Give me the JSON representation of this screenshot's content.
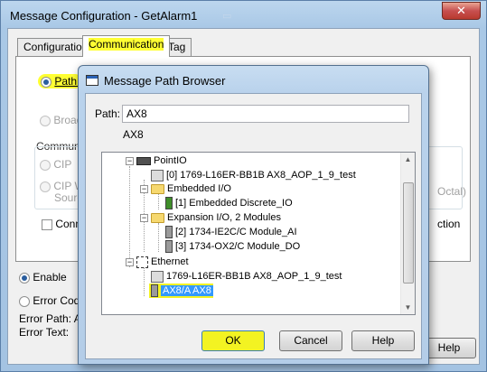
{
  "outer_window": {
    "title": "Message Configuration - GetAlarm1",
    "close_label": "✕",
    "tabs": [
      {
        "label": "Configuration"
      },
      {
        "label": "Communication"
      },
      {
        "label": "Tag"
      }
    ],
    "path_label": "Path:",
    "broadcast_label": "Broad",
    "comm_method_label": "Communi",
    "cip_label": "CIP",
    "cip_with_label": "CIP W",
    "source_label": "Source",
    "octal_label": "Octal)",
    "connected_label": "Conn",
    "cached_label": "ction",
    "enable_label": "Enable",
    "error_code_label": "Error Code",
    "error_path_label": "Error Path:",
    "error_path_value": "AX",
    "error_text_label": "Error Text:",
    "help_label": "Help"
  },
  "dialog": {
    "title": "Message Path Browser",
    "path_label": "Path:",
    "path_value": "AX8",
    "path_display": "AX8",
    "ok_label": "OK",
    "cancel_label": "Cancel",
    "help_label": "Help",
    "tree": [
      {
        "label": "PointIO",
        "icon": "rack-icon"
      },
      {
        "label": "[0] 1769-L16ER-BB1B AX8_AOP_1_9_test",
        "icon": "controller-icon"
      },
      {
        "label": "Embedded I/O",
        "icon": "folder-icon"
      },
      {
        "label": "[1] Embedded Discrete_IO",
        "icon": "module-icon"
      },
      {
        "label": "Expansion I/O, 2 Modules",
        "icon": "folder-icon"
      },
      {
        "label": "[2] 1734-IE2C/C Module_AI",
        "icon": "module-icon"
      },
      {
        "label": "[3] 1734-OX2/C Module_DO",
        "icon": "module-icon"
      },
      {
        "label": "Ethernet",
        "icon": "network-icon"
      },
      {
        "label": "1769-L16ER-BB1B AX8_AOP_1_9_test",
        "icon": "controller-icon"
      },
      {
        "label": "AX8/A AX8",
        "icon": "module-icon"
      }
    ]
  },
  "colors": {
    "highlight": "#ffff33",
    "selection": "#3399ff"
  }
}
